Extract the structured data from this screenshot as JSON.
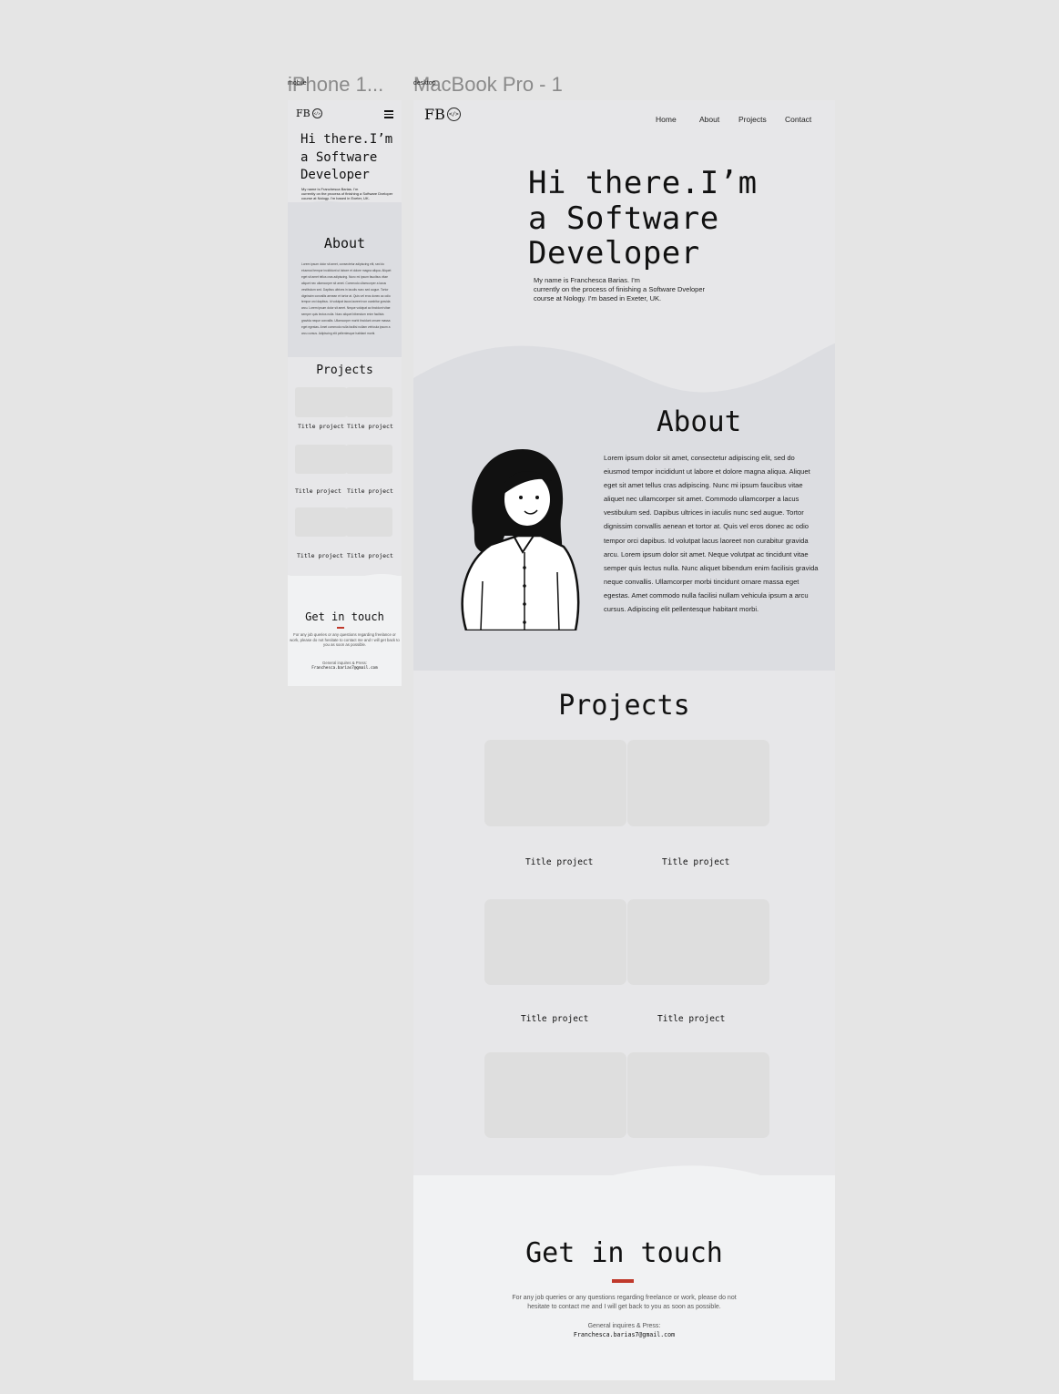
{
  "frames": {
    "mobile": {
      "title": "iPhone 1...",
      "label": "mobile"
    },
    "desktop": {
      "title": "MacBook Pro - 1",
      "label": "desktop"
    }
  },
  "logo": {
    "text": "FB",
    "icon_text": "</>"
  },
  "nav": {
    "home": "Home",
    "about": "About",
    "projects": "Projects",
    "contact": "Contact"
  },
  "hero": {
    "line1": "Hi there.I’m",
    "line2": "a Software",
    "line3": "Developer",
    "intro_l1": "My name is Franchesca Barias. I'm",
    "intro_l2": "currently on the process of finishing a Software Dveloper",
    "intro_l3": "course at Nology. I'm based in Exeter, UK."
  },
  "about": {
    "title": "About",
    "text": "Lorem ipsum dolor sit amet, consectetur adipiscing elit, sed do eiusmod tempor incididunt ut labore et dolore magna aliqua. Aliquet eget sit amet tellus cras adipiscing. Nunc mi ipsum faucibus vitae aliquet nec ullamcorper sit amet. Commodo ullamcorper a lacus vestibulum sed. Dapibus ultrices in iaculis nunc sed augue. Tortor dignissim convallis aenean et tortor at. Quis vel eros donec ac odio tempor orci dapibus. Id volutpat lacus laoreet non curabitur gravida arcu. Lorem ipsum dolor sit amet. Neque volutpat ac tincidunt vitae semper quis lectus nulla. Nunc aliquet bibendum enim facilisis gravida neque convallis. Ullamcorper morbi tincidunt ornare massa eget egestas. Amet commodo nulla facilisi nullam vehicula ipsum a arcu cursus. Adipiscing elit pellentesque habitant morbi."
  },
  "projects": {
    "title": "Projects",
    "item_title": "Title project",
    "items": [
      "Title project",
      "Title project",
      "Title project",
      "Title project",
      "Title project",
      "Title project"
    ]
  },
  "contact": {
    "title": "Get in touch",
    "text_l1": "For any job queries or any questions regarding freelance or work, please do not",
    "text_l2": "hesitate to contact me and I will get back to you as soon as possible.",
    "general": "General inquires & Press:",
    "email": "Franchesca.barias7@gmail.com"
  },
  "colors": {
    "accent": "#c0392b",
    "page_bg": "#e5e5e5",
    "section_bg": "#dcdde1",
    "card_bg": "#dedede",
    "contact_bg": "#f1f2f3"
  }
}
